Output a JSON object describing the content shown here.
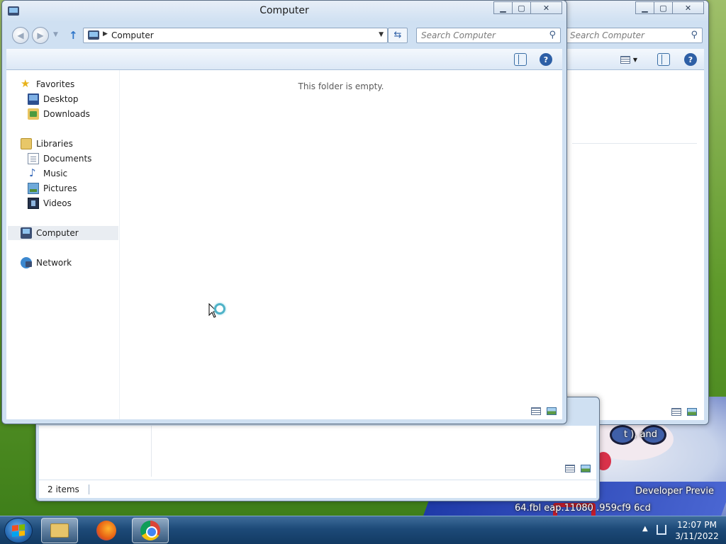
{
  "front_window": {
    "title": "Computer",
    "address": {
      "crumb": "Computer"
    },
    "search": {
      "placeholder": "Search Computer"
    },
    "navigation": {
      "favorites": {
        "label": "Favorites",
        "items": [
          "Desktop",
          "Downloads"
        ]
      },
      "libraries": {
        "label": "Libraries",
        "items": [
          "Documents",
          "Music",
          "Pictures",
          "Videos"
        ]
      },
      "computer": {
        "label": "Computer"
      },
      "network": {
        "label": "Network"
      }
    },
    "empty_message": "This folder is empty.",
    "selected_nav": "Computer"
  },
  "back_window": {
    "search": {
      "placeholder": "Search Computer"
    }
  },
  "lower_window": {
    "status": "2 items"
  },
  "desktop": {
    "watermark_a": "t         ), and",
    "watermark_b": "Developer Previe",
    "watermark_c": "64.fbl  eap.11080         .959cf9         6cd"
  },
  "taskbar": {
    "clock_time": "12:07 PM",
    "clock_date": "3/11/2022"
  },
  "colors": {
    "window_frame": "#cfe0f2",
    "taskbar": "#1d4a78",
    "accent": "#2d5fa6"
  },
  "icons": [
    "star-icon",
    "desktop-icon",
    "downloads-folder-icon",
    "libraries-icon",
    "documents-icon",
    "music-icon",
    "pictures-icon",
    "videos-icon",
    "computer-icon",
    "network-icon",
    "help-icon",
    "preview-pane-icon",
    "details-view-icon",
    "large-icons-view-icon",
    "start-orb-icon",
    "explorer-icon",
    "firefox-icon",
    "chrome-icon"
  ]
}
